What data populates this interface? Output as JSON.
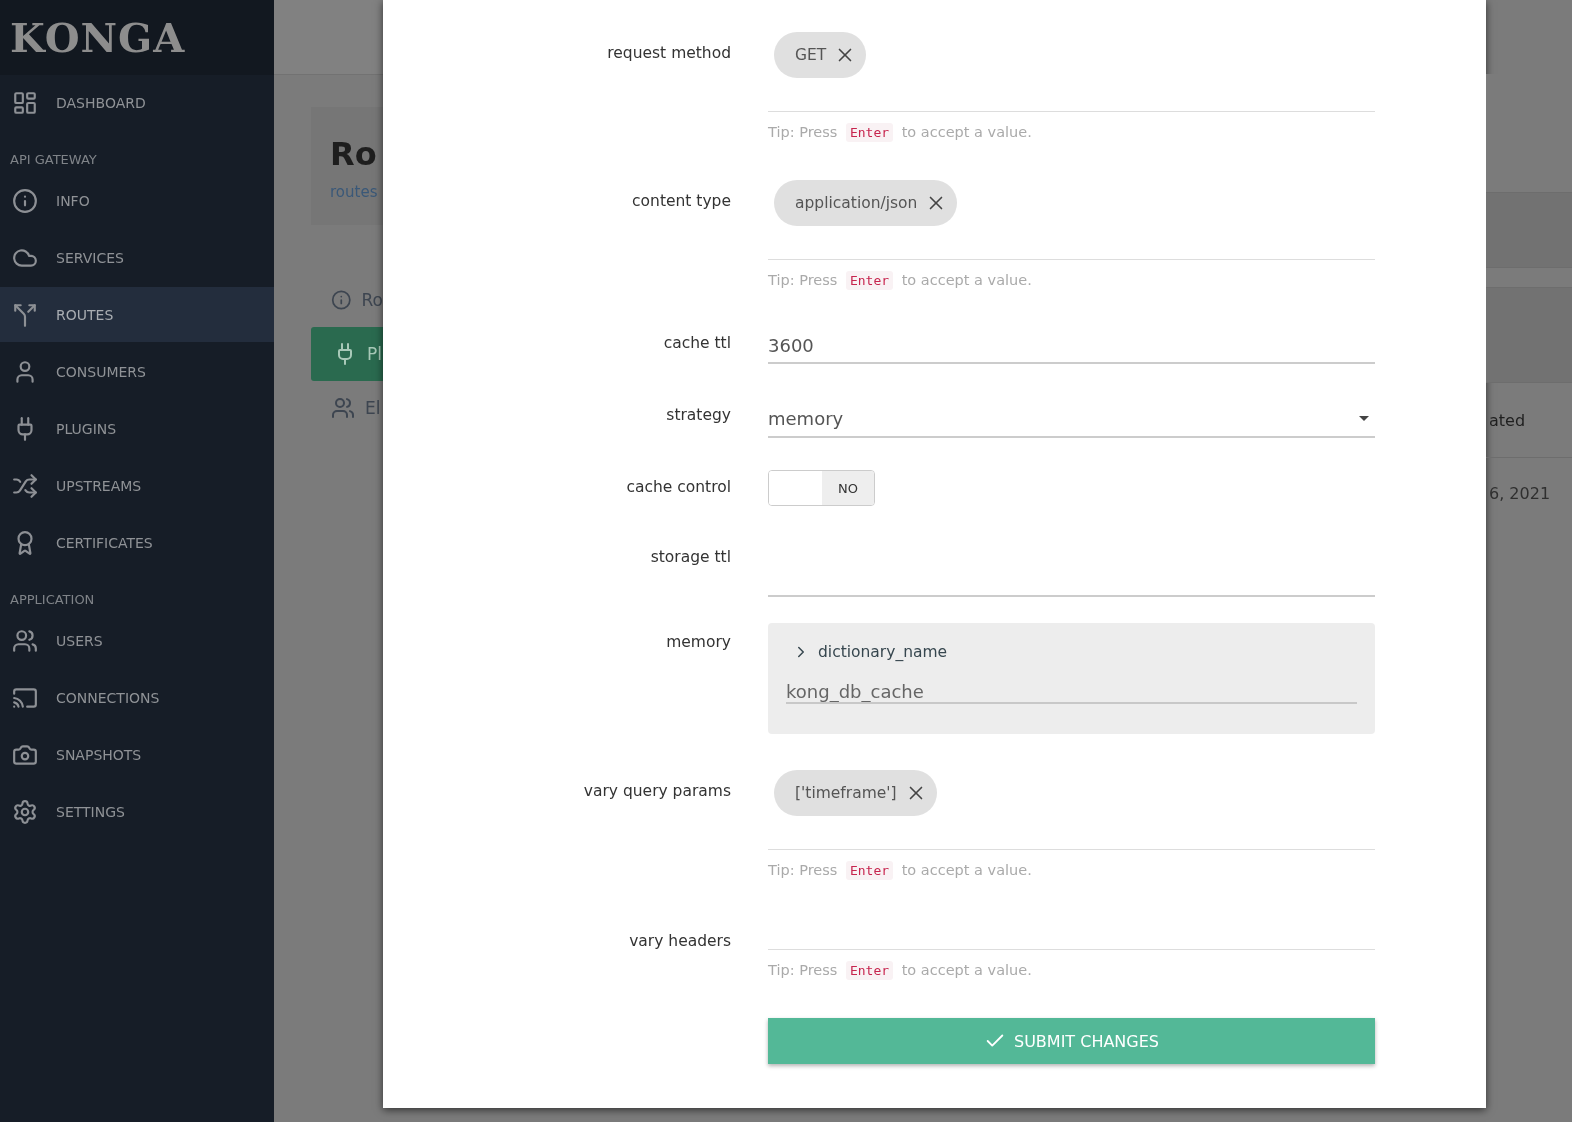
{
  "sidebar": {
    "logo": "KONGA",
    "items": [
      {
        "kind": "link",
        "label": "DASHBOARD",
        "selected": false
      },
      {
        "kind": "header",
        "label": "API GATEWAY"
      },
      {
        "kind": "link",
        "label": "INFO",
        "selected": false
      },
      {
        "kind": "link",
        "label": "SERVICES",
        "selected": false
      },
      {
        "kind": "link",
        "label": "ROUTES",
        "selected": true
      },
      {
        "kind": "link",
        "label": "CONSUMERS",
        "selected": false
      },
      {
        "kind": "link",
        "label": "PLUGINS",
        "selected": false
      },
      {
        "kind": "link",
        "label": "UPSTREAMS",
        "selected": false
      },
      {
        "kind": "link",
        "label": "CERTIFICATES",
        "selected": false
      },
      {
        "kind": "header",
        "label": "APPLICATION"
      },
      {
        "kind": "link",
        "label": "USERS",
        "selected": false
      },
      {
        "kind": "link",
        "label": "CONNECTIONS",
        "selected": false
      },
      {
        "kind": "link",
        "label": "SNAPSHOTS",
        "selected": false
      },
      {
        "kind": "link",
        "label": "SETTINGS",
        "selected": false
      }
    ]
  },
  "background_page": {
    "title": "Ro",
    "breadcrumb": "routes",
    "tabs": [
      {
        "label": "Ro",
        "selected": false
      },
      {
        "label": "Pl",
        "selected": true
      },
      {
        "label": "El",
        "selected": false
      }
    ],
    "column_heading": "ated",
    "cell": "6, 2021"
  },
  "form": {
    "fields": [
      {
        "kind": "tags",
        "label": "request method",
        "tags": [
          "GET"
        ],
        "tip": {
          "before": "Tip: Press",
          "key": "Enter",
          "after": "to accept a value."
        }
      },
      {
        "kind": "tags",
        "label": "content type",
        "tags": [
          "application/json"
        ],
        "tip": {
          "before": "Tip: Press",
          "key": "Enter",
          "after": "to accept a value."
        }
      },
      {
        "kind": "text",
        "label": "cache ttl",
        "value": "3600"
      },
      {
        "kind": "select",
        "label": "strategy",
        "value": "memory"
      },
      {
        "kind": "toggle",
        "label": "cache control",
        "on": false,
        "state_label": "NO"
      },
      {
        "kind": "text",
        "label": "storage ttl"
      },
      {
        "kind": "object",
        "label": "memory",
        "key": "dictionary_name",
        "value": "kong_db_cache"
      },
      {
        "kind": "tags",
        "label": "vary query params",
        "tags": [
          "['timeframe']"
        ],
        "tip": {
          "before": "Tip: Press",
          "key": "Enter",
          "after": "to accept a value."
        }
      },
      {
        "kind": "tags",
        "label": "vary headers",
        "tip": {
          "before": "Tip: Press",
          "key": "Enter",
          "after": "to accept a value."
        }
      }
    ],
    "submit": "SUBMIT CHANGES"
  }
}
